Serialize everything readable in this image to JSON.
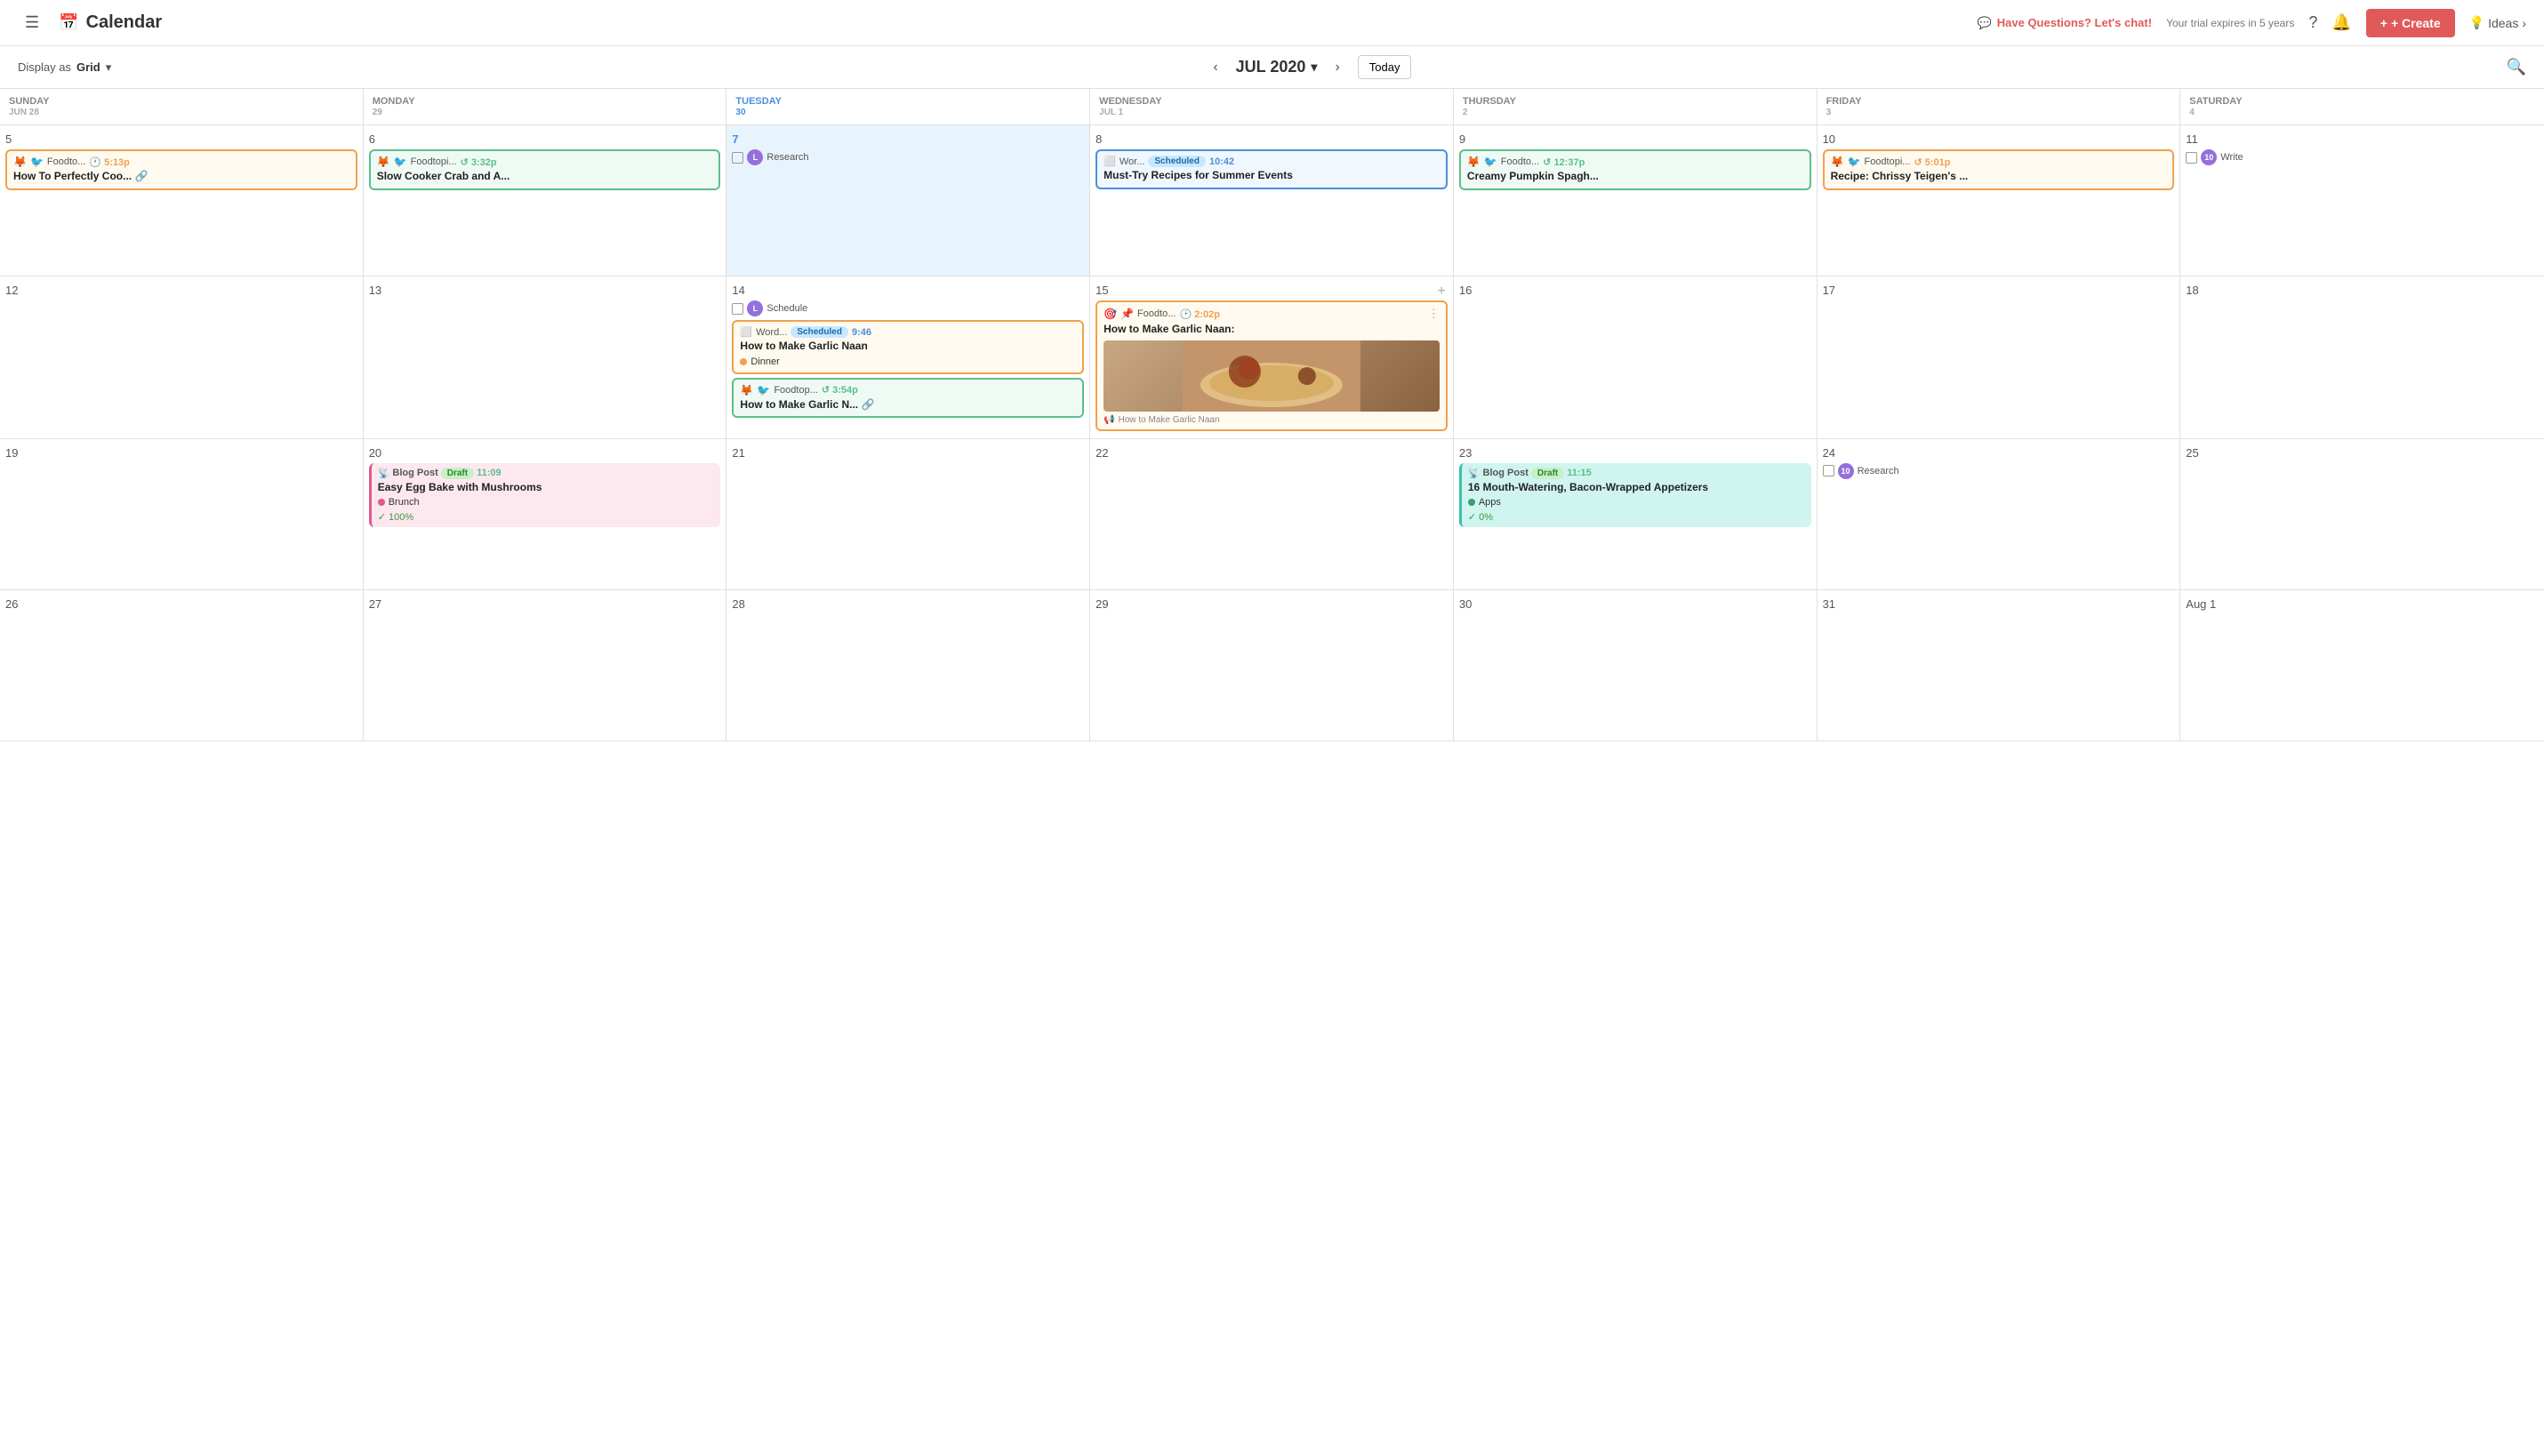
{
  "app": {
    "title": "Calendar",
    "icon": "calendar-icon"
  },
  "header": {
    "chat_text": "Have Questions? Let's chat!",
    "trial_text": "Your trial expires in 5 years",
    "create_label": "+ Create",
    "ideas_label": "Ideas"
  },
  "sub_header": {
    "display_as_label": "Display as",
    "grid_label": "Grid",
    "month": "JUL 2020",
    "today_label": "Today"
  },
  "day_headers": [
    "SUNDAY",
    "MONDAY",
    "TUESDAY",
    "WEDNESDAY",
    "THURSDAY",
    "FRIDAY",
    "SATURDAY"
  ],
  "weeks": [
    {
      "days": [
        {
          "date": "Jun 28",
          "day_num": "5",
          "today": false,
          "events": [
            {
              "type": "social",
              "icons": [
                "🦊",
                "🐦"
              ],
              "channel": "Foodto...",
              "time": "5:13p",
              "time_color": "orange",
              "title": "How To Perfectly Coo...",
              "has_link": true,
              "border": "orange"
            }
          ]
        },
        {
          "date": "29",
          "day_num": "6",
          "today": false,
          "events": [
            {
              "type": "social",
              "icons": [
                "🦊",
                "🐦"
              ],
              "channel": "Foodtopi...",
              "time": "3:32p",
              "time_color": "green",
              "title": "Slow Cooker Crab and A...",
              "border": "green"
            }
          ]
        },
        {
          "date": "30",
          "day_num": "7",
          "today": true,
          "events": [
            {
              "type": "task",
              "title": "Research",
              "has_checkbox": true,
              "has_avatar": true
            }
          ]
        },
        {
          "date": "Jul 1",
          "day_num": "8",
          "today": false,
          "events": [
            {
              "type": "blog",
              "platform": "wordpress",
              "channel": "Wor...",
              "status": "Scheduled",
              "time": "10:42",
              "time_color": "blue",
              "title": "Must-Try Recipes for Summer Events",
              "border": "blue"
            }
          ]
        },
        {
          "date": "2",
          "day_num": "9",
          "today": false,
          "events": [
            {
              "type": "social",
              "icons": [
                "🦊",
                "🐦"
              ],
              "channel": "Foodto...",
              "time": "12:37p",
              "time_color": "green",
              "title": "Creamy Pumpkin Spagh...",
              "border": "green"
            }
          ]
        },
        {
          "date": "3",
          "day_num": "10",
          "today": false,
          "events": [
            {
              "type": "social",
              "icons": [
                "🦊",
                "🐦"
              ],
              "channel": "Foodtopi...",
              "time": "5:01p",
              "time_color": "orange",
              "title": "Recipe: Chrissy Teigen's ...",
              "border": "orange"
            }
          ]
        },
        {
          "date": "4",
          "day_num": "11",
          "today": false,
          "events": [
            {
              "type": "task",
              "title": "Write",
              "has_checkbox": true,
              "has_avatar": true
            }
          ]
        }
      ]
    },
    {
      "days": [
        {
          "date": "",
          "day_num": "12",
          "today": false,
          "events": []
        },
        {
          "date": "",
          "day_num": "13",
          "today": false,
          "events": []
        },
        {
          "date": "",
          "day_num": "14",
          "today": false,
          "events": [
            {
              "type": "task",
              "title": "Schedule",
              "has_checkbox": true,
              "has_avatar": true
            },
            {
              "type": "blog",
              "platform": "wordpress",
              "channel": "Word...",
              "status": "Scheduled",
              "time": "9:46",
              "time_color": "blue",
              "title": "How to Make Garlic Naan",
              "tag": "Dinner",
              "tag_color": "orange",
              "border": "orange"
            },
            {
              "type": "social",
              "icons": [
                "🦊",
                "🐦"
              ],
              "channel": "Foodtop...",
              "time": "3:54p",
              "time_color": "green",
              "title": "How to Make Garlic N...",
              "has_link": true,
              "border": "green"
            }
          ]
        },
        {
          "date": "",
          "day_num": "15",
          "today": false,
          "has_plus": true,
          "events": [
            {
              "type": "naan_featured",
              "icons": [
                "🎯",
                "📌"
              ],
              "channel": "Foodto...",
              "time": "2:02p",
              "time_color": "orange",
              "title": "How to Make Garlic Naan:",
              "border": "orange"
            }
          ]
        },
        {
          "date": "",
          "day_num": "16",
          "today": false,
          "events": []
        },
        {
          "date": "",
          "day_num": "17",
          "today": false,
          "events": []
        },
        {
          "date": "",
          "day_num": "18",
          "today": false,
          "events": []
        }
      ]
    },
    {
      "days": [
        {
          "date": "",
          "day_num": "19",
          "today": false,
          "events": []
        },
        {
          "date": "",
          "day_num": "20",
          "today": false,
          "events": [
            {
              "type": "blog_post",
              "platform": "rss",
              "channel": "Blog Post",
              "status": "Draft",
              "time": "11:09",
              "time_color": "green",
              "title": "Easy Egg Bake with Mushrooms",
              "tag": "Brunch",
              "tag_color": "pink",
              "progress": "100%",
              "bg": "pink"
            }
          ]
        },
        {
          "date": "",
          "day_num": "21",
          "today": false,
          "events": []
        },
        {
          "date": "",
          "day_num": "22",
          "today": false,
          "events": []
        },
        {
          "date": "",
          "day_num": "23",
          "today": false,
          "events": [
            {
              "type": "blog_post",
              "platform": "rss",
              "channel": "Blog Post",
              "status": "Draft",
              "time": "11:15",
              "time_color": "green",
              "title": "16 Mouth-Watering, Bacon-Wrapped Appetizers",
              "tag": "Apps",
              "tag_color": "green",
              "progress": "0%",
              "bg": "teal"
            }
          ]
        },
        {
          "date": "",
          "day_num": "24",
          "today": false,
          "events": [
            {
              "type": "task",
              "title": "Research",
              "has_checkbox": true,
              "has_avatar": true
            }
          ]
        },
        {
          "date": "",
          "day_num": "25",
          "today": false,
          "events": []
        }
      ]
    },
    {
      "days": [
        {
          "date": "",
          "day_num": "26",
          "today": false,
          "events": []
        },
        {
          "date": "",
          "day_num": "27",
          "today": false,
          "events": []
        },
        {
          "date": "",
          "day_num": "28",
          "today": false,
          "events": []
        },
        {
          "date": "",
          "day_num": "29",
          "today": false,
          "events": []
        },
        {
          "date": "",
          "day_num": "30",
          "today": false,
          "events": []
        },
        {
          "date": "",
          "day_num": "31",
          "today": false,
          "events": []
        },
        {
          "date": "Aug 1",
          "day_num": "Aug 1",
          "today": false,
          "events": []
        }
      ]
    }
  ],
  "icons": {
    "menu": "☰",
    "calendar_emoji": "📅",
    "question": "?",
    "bell": "🔔",
    "search": "🔍",
    "bulb": "💡",
    "chevron_down": "▾",
    "arrow_left": "‹",
    "arrow_right": "›",
    "plus": "+"
  }
}
